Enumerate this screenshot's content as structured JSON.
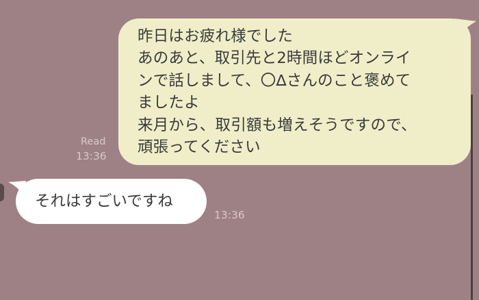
{
  "messages": {
    "sent": {
      "lines": [
        "昨日はお疲れ様でした",
        "あのあと、取引先と2時間ほどオンライ",
        "ンで話しまして、〇∆さんのこと褒めて",
        "ましたよ",
        "来月から、取引額も増えそうですので、",
        "頑張ってください"
      ],
      "read_label": "Read",
      "time": "13:36"
    },
    "received": {
      "text": "それはすごいですね",
      "time": "13:36"
    }
  },
  "colors": {
    "background": "#9e8185",
    "sent_bubble": "#efeec9",
    "received_bubble": "#ffffff",
    "meta_text": "#d9c9ca",
    "message_text": "#3a3a3a"
  }
}
